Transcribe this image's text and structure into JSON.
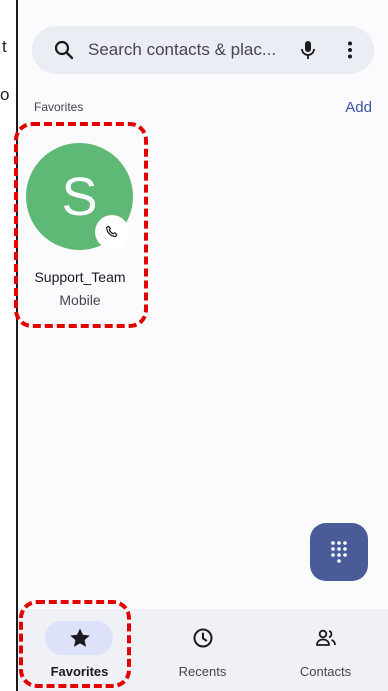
{
  "left_fragments": [
    "t",
    "o"
  ],
  "search": {
    "placeholder": "Search contacts & plac..."
  },
  "favorites_section": {
    "label": "Favorites",
    "add_label": "Add"
  },
  "favorite_contact": {
    "initial": "S",
    "name": "Support_Team",
    "type": "Mobile"
  },
  "bottom_nav": {
    "items": [
      {
        "label": "Favorites",
        "icon": "star-icon",
        "active": true
      },
      {
        "label": "Recents",
        "icon": "clock-icon",
        "active": false
      },
      {
        "label": "Contacts",
        "icon": "people-icon",
        "active": false
      }
    ]
  },
  "colors": {
    "avatar": "#5fb976",
    "accent": "#3a53a8",
    "fab": "#4a5b9a",
    "highlight": "#e30000"
  }
}
